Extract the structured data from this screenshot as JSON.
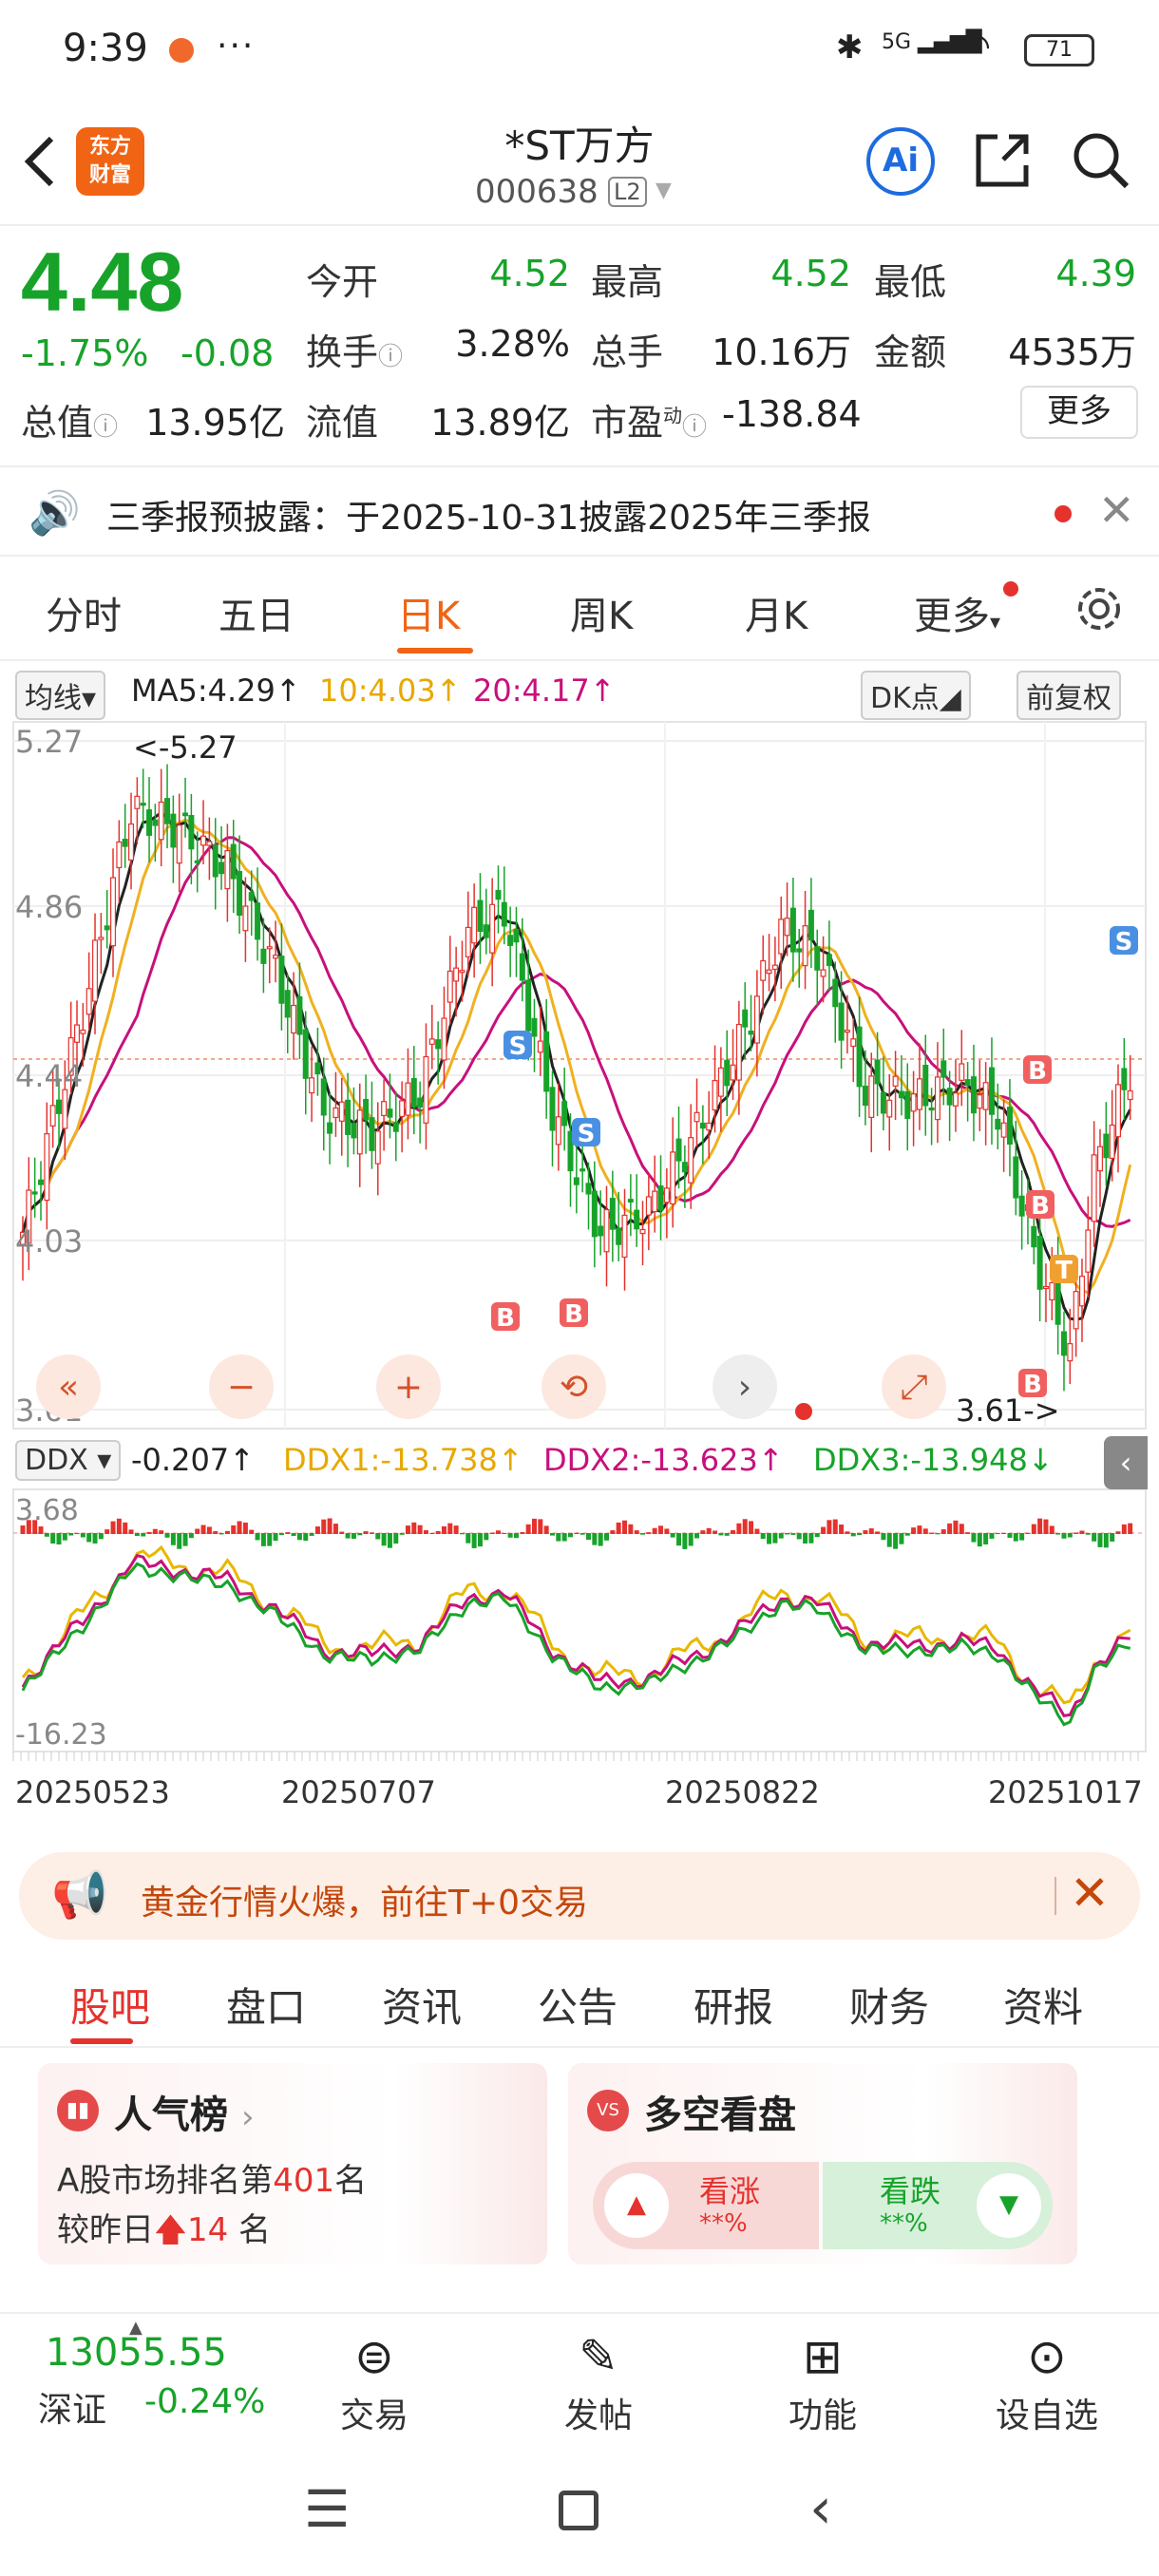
{
  "status_bar": {
    "time": "9:39",
    "battery": "71",
    "signal": "5G"
  },
  "header": {
    "stock_name": "*ST万方",
    "stock_code": "000638",
    "level_badge": "L2",
    "logo_line1": "东方",
    "logo_line2": "财富",
    "ai_label": "Ai"
  },
  "quote": {
    "price": "4.48",
    "change_pct": "-1.75%",
    "change_abs": "-0.08",
    "open_label": "今开",
    "open": "4.52",
    "high_label": "最高",
    "high": "4.52",
    "low_label": "最低",
    "low": "4.39",
    "turnover_label": "换手",
    "turnover": "3.28%",
    "volume_label": "总手",
    "volume": "10.16万",
    "amount_label": "金额",
    "amount": "4535万",
    "mktcap_label": "总值",
    "mktcap": "13.95亿",
    "float_label": "流值",
    "float_cap": "13.89亿",
    "pe_label": "市盈",
    "pe_sup": "动",
    "pe": "-138.84",
    "more": "更多"
  },
  "notice": {
    "text": "三季报预披露：于2025-10-31披露2025年三季报"
  },
  "period_tabs": [
    "分时",
    "五日",
    "日K",
    "周K",
    "月K",
    "更多"
  ],
  "active_period": "日K",
  "ma_legend": {
    "selector": "均线",
    "ma5": "MA5:4.29↑",
    "ma10": "10:4.03↑",
    "ma20": "20:4.17↑",
    "dk": "DK点",
    "adjust": "前复权"
  },
  "ddx_legend": {
    "selector": "DDX",
    "ddx": "-0.207↑",
    "ddx1": "DDX1:-13.738↑",
    "ddx2": "DDX2:-13.623↑",
    "ddx3": "DDX3:-13.948↓"
  },
  "chart_data": {
    "type": "candlestick",
    "price_axis_labels": [
      "5.27",
      "4.86",
      "4.44",
      "4.03",
      "3.61"
    ],
    "ylim": [
      3.61,
      5.27
    ],
    "high_marker": "<-5.27",
    "low_marker": "3.61->",
    "ddx_axis_labels": [
      "3.68",
      "-16.23"
    ],
    "x_dates": [
      "20250523",
      "20250707",
      "20250822",
      "20251017"
    ],
    "colors": {
      "up": "#e5322d",
      "down": "#17a32a",
      "ma5": "#222222",
      "ma10": "#f0b020",
      "ma20": "#c8107c"
    },
    "trade_signals": [
      "B",
      "S",
      "B",
      "S",
      "B",
      "S",
      "B",
      "T",
      "B"
    ],
    "chart_controls": [
      "«",
      "−",
      "+",
      "⟲",
      "›",
      "⤢"
    ]
  },
  "promo": {
    "text": "黄金行情火爆，前往T+0交易"
  },
  "content_tabs": [
    "股吧",
    "盘口",
    "资讯",
    "公告",
    "研报",
    "财务",
    "资料"
  ],
  "popularity": {
    "title": "人气榜",
    "rank_prefix": "A股市场排名第",
    "rank": "401",
    "rank_suffix": "名",
    "change_prefix": "较昨日",
    "change": "14",
    "change_suffix": "名"
  },
  "vote": {
    "title": "多空看盘",
    "bull": "看涨",
    "bull_val": "**%",
    "bear": "看跌",
    "bear_val": "**%"
  },
  "index": {
    "value": "13055.55",
    "name": "深证",
    "change": "-0.24%"
  },
  "bottom_nav": [
    "交易",
    "发帖",
    "功能",
    "设自选"
  ]
}
